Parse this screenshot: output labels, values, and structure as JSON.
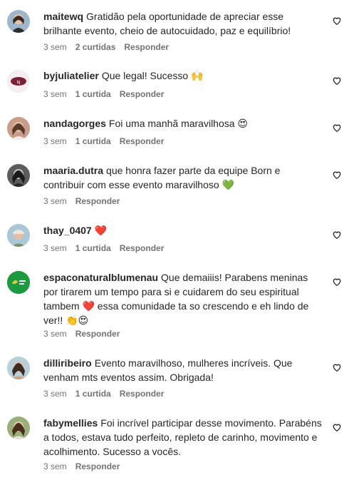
{
  "comments": [
    {
      "user": "maitewq",
      "text": "Gratidão pela oportunidade de apreciar esse brilhante evento, cheio de autocuidado, paz e equilíbrio!",
      "time": "3 sem",
      "likes": "2 curtidas",
      "reply": "Responder"
    },
    {
      "user": "byjuliatelier",
      "text": "Que legal! Sucesso 🙌",
      "time": "3 sem",
      "likes": "1 curtida",
      "reply": "Responder"
    },
    {
      "user": "nandagorges",
      "text": "Foi uma manhã maravilhosa 😍",
      "time": "3 sem",
      "likes": "1 curtida",
      "reply": "Responder"
    },
    {
      "user": "maaria.dutra",
      "text": "que honra fazer parte da equipe Born e contribuir com esse evento maravilhoso 💚",
      "time": "3 sem",
      "likes": "",
      "reply": "Responder"
    },
    {
      "user": "thay_0407",
      "text": "❤️",
      "time": "3 sem",
      "likes": "1 curtida",
      "reply": "Responder"
    },
    {
      "user": "espaconaturalblumenau",
      "text": "Que demaiiis! Parabens meninas por tirarem um tempo para si e cuidarem do seu espiritual tambem ❤️ essa comunidade ta so crescendo e eh lindo de ver!! 👏😍",
      "time": "3 sem",
      "likes": "",
      "reply": "Responder"
    },
    {
      "user": "dilliribeiro",
      "text": "Evento maravilhoso, mulheres incríveis. Que venham mts eventos assim. Obrigada!",
      "time": "3 sem",
      "likes": "1 curtida",
      "reply": "Responder"
    },
    {
      "user": "fabymellies",
      "text": "Foi incrível participar desse movimento. Parabéns a todos, estava tudo perfeito, repleto de carinho, movimento e acolhimento. Sucesso a vocês.",
      "time": "3 sem",
      "likes": "",
      "reply": "Responder"
    }
  ],
  "icons": {
    "like": "heart-outline-icon"
  },
  "colors": {
    "text": "#262626",
    "meta": "#737373",
    "heart_red": "#ff3040",
    "green_emoji": "#3cb043"
  }
}
